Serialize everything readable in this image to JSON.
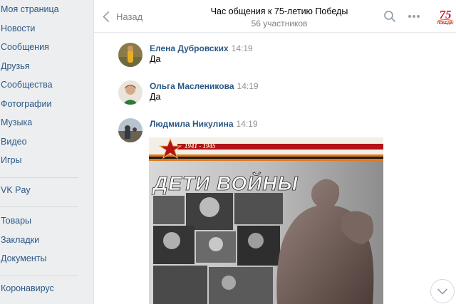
{
  "sidebar": {
    "items": [
      {
        "label": "Моя страница"
      },
      {
        "label": "Новости"
      },
      {
        "label": "Сообщения"
      },
      {
        "label": "Друзья"
      },
      {
        "label": "Сообщества"
      },
      {
        "label": "Фотографии"
      },
      {
        "label": "Музыка"
      },
      {
        "label": "Видео"
      },
      {
        "label": "Игры"
      }
    ],
    "pay": {
      "label": "VK Pay"
    },
    "items2": [
      {
        "label": "Товары"
      },
      {
        "label": "Закладки"
      },
      {
        "label": "Документы"
      }
    ],
    "items3": [
      {
        "label": "Коронавирус"
      }
    ]
  },
  "header": {
    "back_label": "Назад",
    "title": "Час общения к 75-летию Победы",
    "subtitle": "56 участников",
    "logo_text": "75",
    "logo_sub": "ПОБЕДА!"
  },
  "messages": [
    {
      "author": "Елена Дубровских",
      "time": "14:19",
      "text": "Да"
    },
    {
      "author": "Ольга Масленикова",
      "time": "14:19",
      "text": "Да"
    },
    {
      "author": "Людмила Никулина",
      "time": "14:19",
      "text": ""
    }
  ],
  "poster": {
    "years": "1941 - 1945",
    "title": "ДЕТИ ВОЙНЫ"
  },
  "colors": {
    "link": "#2a5885",
    "muted": "#828282",
    "background": "#edeef0",
    "ribbon_orange": "#e07a1a",
    "poster_red": "#b3121a"
  }
}
